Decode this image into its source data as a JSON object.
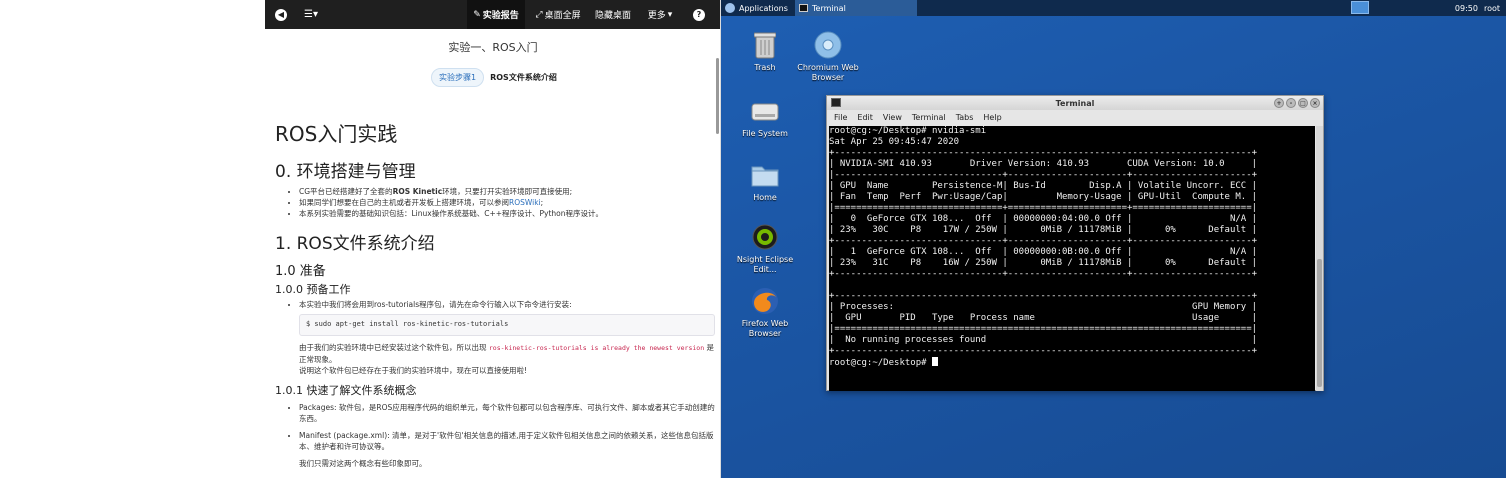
{
  "doc": {
    "toolbar": {
      "back_icon": "arrow-left-icon",
      "list_icon": "list-icon",
      "report_label": "实验报告",
      "fullscreen_label": "桌面全屏",
      "hide_label": "隐藏桌面",
      "more_label": "更多",
      "help_label": "?"
    },
    "title": "实验一、ROS入门",
    "step": {
      "pill": "实验步骤1",
      "label": "ROS文件系统介绍"
    },
    "h1": "ROS入门实践",
    "s0_title": "0. 环境搭建与管理",
    "s0_bullets": {
      "b1_pre": "CG平台已经搭建好了全套的",
      "b1_bold": "ROS Kinetic",
      "b1_post": "环境，只要打开实验环境即可直接使用;",
      "b2_pre": "如果同学们想要在自己的主机或者开发板上搭建环境，可以参阅",
      "b2_link": "ROSWiki",
      "b2_post": ";",
      "b3": "本系列实验需要的基础知识包括：Linux操作系统基础、C++程序设计、Python程序设计。"
    },
    "s1_title": "1. ROS文件系统介绍",
    "s1_0_title": "1.0 准备",
    "s1_0_0_title": "1.0.0 预备工作",
    "s1_0_0_bullet": "本实验中我们将会用到ros-tutorials程序包，请先在命令行输入以下命令进行安装:",
    "code": "$ sudo apt-get install ros-kinetic-ros-tutorials",
    "para1_pre": "由于我们的实验环境中已经安装过这个软件包，所以出现 ",
    "para1_code": "ros-kinetic-ros-tutorials is already the newest version",
    "para1_post": " 是正常现象。",
    "para2": "说明这个软件包已经存在于我们的实验环境中，现在可以直接使用啦!",
    "s1_0_1_title": "1.0.1 快速了解文件系统概念",
    "s1_0_1_bullets": {
      "b1": "Packages: 软件包，是ROS应用程序代码的组织单元，每个软件包都可以包含程序库、可执行文件、脚本或者其它手动创建的东西。",
      "b2": "Manifest (package.xml): 清单，是对于'软件包'相关信息的描述,用于定义软件包相关信息之间的依赖关系，这些信息包括版本、维护者和许可协议等。"
    },
    "para3": "我们只需对这两个概念有些印象即可。"
  },
  "desktop": {
    "taskbar": {
      "apps_label": "Applications",
      "task_label": "Terminal",
      "time": "09:50",
      "user": "root"
    },
    "icons": [
      {
        "name": "Trash",
        "icon": "trash-icon"
      },
      {
        "name": "Chromium Web Browser",
        "icon": "chromium-icon"
      },
      {
        "name": "File System",
        "icon": "drive-icon"
      },
      {
        "name": "Home",
        "icon": "home-folder-icon"
      },
      {
        "name": "Nsight Eclipse Edit...",
        "icon": "nsight-icon"
      },
      {
        "name": "Firefox Web Browser",
        "icon": "firefox-icon"
      }
    ],
    "terminal": {
      "title": "Terminal",
      "menu": [
        "File",
        "Edit",
        "View",
        "Terminal",
        "Tabs",
        "Help"
      ],
      "lines": [
        "root@cg:~/Desktop# nvidia-smi",
        "Sat Apr 25 09:45:47 2020",
        "+-----------------------------------------------------------------------------+",
        "| NVIDIA-SMI 410.93       Driver Version: 410.93       CUDA Version: 10.0     |",
        "|-------------------------------+----------------------+----------------------+",
        "| GPU  Name        Persistence-M| Bus-Id        Disp.A | Volatile Uncorr. ECC |",
        "| Fan  Temp  Perf  Pwr:Usage/Cap|         Memory-Usage | GPU-Util  Compute M. |",
        "|===============================+======================+======================|",
        "|   0  GeForce GTX 108...  Off  | 00000000:04:00.0 Off |                  N/A |",
        "| 23%   30C    P8    17W / 250W |      0MiB / 11178MiB |      0%      Default |",
        "+-------------------------------+----------------------+----------------------+",
        "|   1  GeForce GTX 108...  Off  | 00000000:0B:00.0 Off |                  N/A |",
        "| 23%   31C    P8    16W / 250W |      0MiB / 11178MiB |      0%      Default |",
        "+-------------------------------+----------------------+----------------------+",
        "",
        "+-----------------------------------------------------------------------------+",
        "| Processes:                                                       GPU Memory |",
        "|  GPU       PID   Type   Process name                             Usage      |",
        "|=============================================================================|",
        "|  No running processes found                                                 |",
        "+-----------------------------------------------------------------------------+",
        "root@cg:~/Desktop# "
      ]
    }
  }
}
